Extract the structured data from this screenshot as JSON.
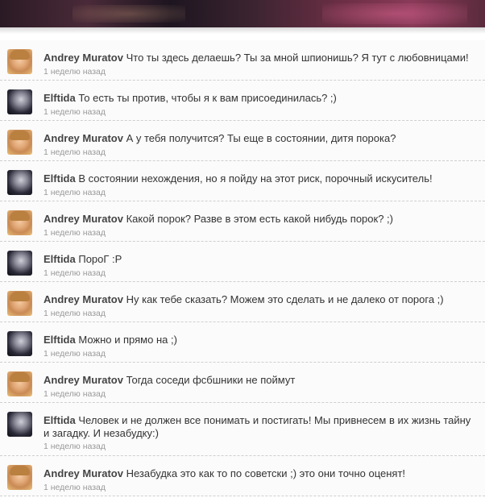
{
  "tweets": [
    {
      "author": "Andrey Muratov",
      "avatar": "andrey-avatar",
      "text": "Что ты здесь делаешь? Ты за мной шпионишь? Я тут с любовницами!",
      "time": "1 неделю назад"
    },
    {
      "author": "Elftida",
      "avatar": "elftida-avatar",
      "text": "То есть ты против, чтобы я к вам присоединилась? ;)",
      "time": "1 неделю назад"
    },
    {
      "author": "Andrey Muratov",
      "avatar": "andrey-avatar",
      "text": "А у тебя получится? Ты еще в состоянии, дитя порока?",
      "time": "1 неделю назад"
    },
    {
      "author": "Elftida",
      "avatar": "elftida-avatar",
      "text": "В состоянии нехождения, но я пойду на этот риск, порочный искуситель!",
      "time": "1 неделю назад"
    },
    {
      "author": "Andrey Muratov",
      "avatar": "andrey-avatar",
      "text": "Какой порок? Разве в этом есть какой нибудь порок? ;)",
      "time": "1 неделю назад"
    },
    {
      "author": "Elftida",
      "avatar": "elftida-avatar",
      "text": "ПороГ :Р",
      "time": "1 неделю назад"
    },
    {
      "author": "Andrey Muratov",
      "avatar": "andrey-avatar",
      "text": "Ну как тебе сказать? Можем это сделать и не далеко от порога ;)",
      "time": "1 неделю назад"
    },
    {
      "author": "Elftida",
      "avatar": "elftida-avatar",
      "text": "Можно и прямо на ;)",
      "time": "1 неделю назад"
    },
    {
      "author": "Andrey Muratov",
      "avatar": "andrey-avatar",
      "text": "Тогда соседи фсбшники не поймут",
      "time": "1 неделю назад"
    },
    {
      "author": "Elftida",
      "avatar": "elftida-avatar",
      "text": "Человек и не должен все понимать и постигать! Мы привнесем в их жизнь тайну и загадку. И незабудку:)",
      "time": "1 неделю назад"
    },
    {
      "author": "Andrey Muratov",
      "avatar": "andrey-avatar",
      "text": "Незабудка это как то по советски ;) это они точно оценят!",
      "time": "1 неделю назад"
    }
  ]
}
